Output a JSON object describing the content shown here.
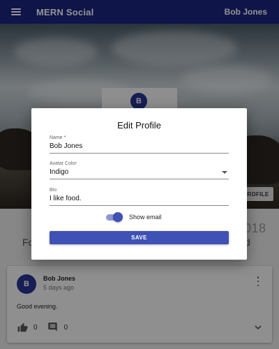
{
  "appbar": {
    "title": "MERN Social",
    "user_name": "Bob Jones"
  },
  "profile": {
    "avatar_initial": "B",
    "edit_button_label": "ROFILE",
    "year_fragment": "018",
    "name_fragment_left": "Fo",
    "name_fragment_right": "d"
  },
  "post": {
    "avatar_initial": "B",
    "author": "Bob Jones",
    "time": "5 days ago",
    "text": "Good evening.",
    "likes": "0",
    "comments": "0"
  },
  "dialog": {
    "title": "Edit Profile",
    "name_label": "Name *",
    "name_value": "Bob Jones",
    "color_label": "Avatar Color",
    "color_value": "Indigo",
    "bio_label": "Bio",
    "bio_value": "I like food.",
    "show_email_label": "Show email",
    "show_email": true,
    "save_label": "SAVE"
  },
  "colors": {
    "appbar": "#1a237e",
    "accent": "#3f51b5",
    "avatar": "#283593"
  },
  "icons": [
    "menu-icon",
    "more-vert-icon",
    "thumb-up-icon",
    "comment-icon",
    "chevron-down-icon",
    "dropdown-arrow-icon"
  ]
}
